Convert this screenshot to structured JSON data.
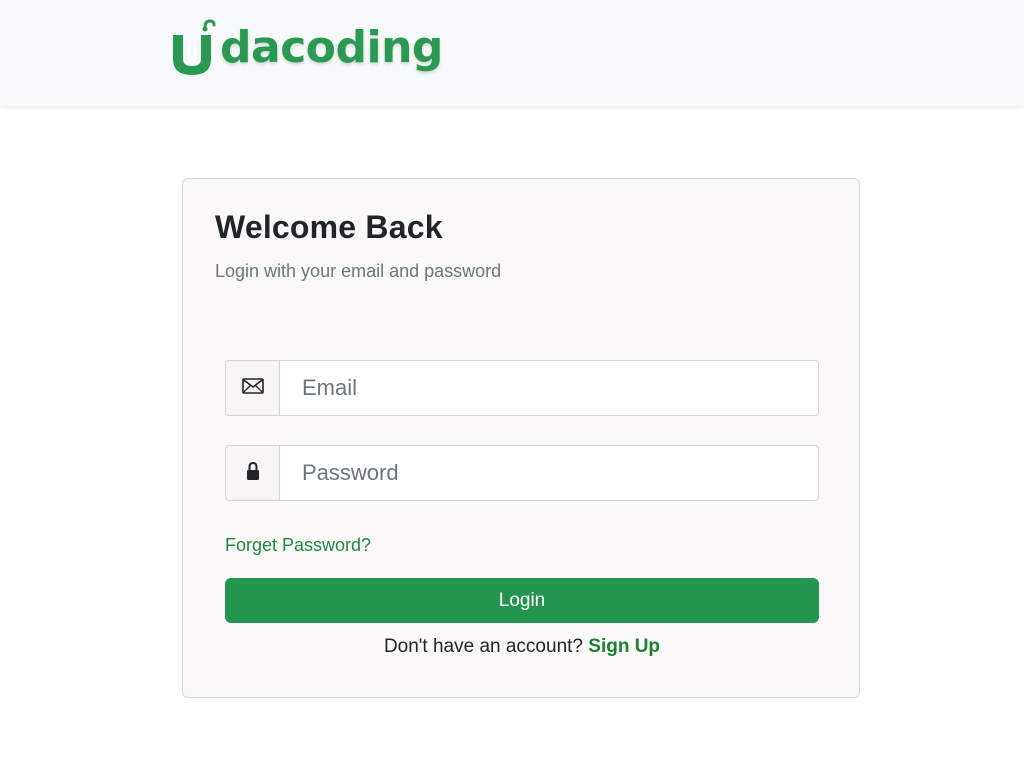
{
  "header": {
    "logo_text": "dacoding",
    "logo_mark_letter": "U",
    "brand_color": "#2a9a52"
  },
  "login_card": {
    "title": "Welcome Back",
    "subtitle": "Login with your email and password",
    "email": {
      "icon": "envelope-icon",
      "placeholder": "Email",
      "value": ""
    },
    "password": {
      "icon": "lock-icon",
      "placeholder": "Password",
      "value": ""
    },
    "forgot_password_label": "Forget Password?",
    "login_button_label": "Login",
    "login_button_color": "#23954f",
    "signup_prompt": "Don't have an account?",
    "signup_link_label": "Sign Up"
  }
}
